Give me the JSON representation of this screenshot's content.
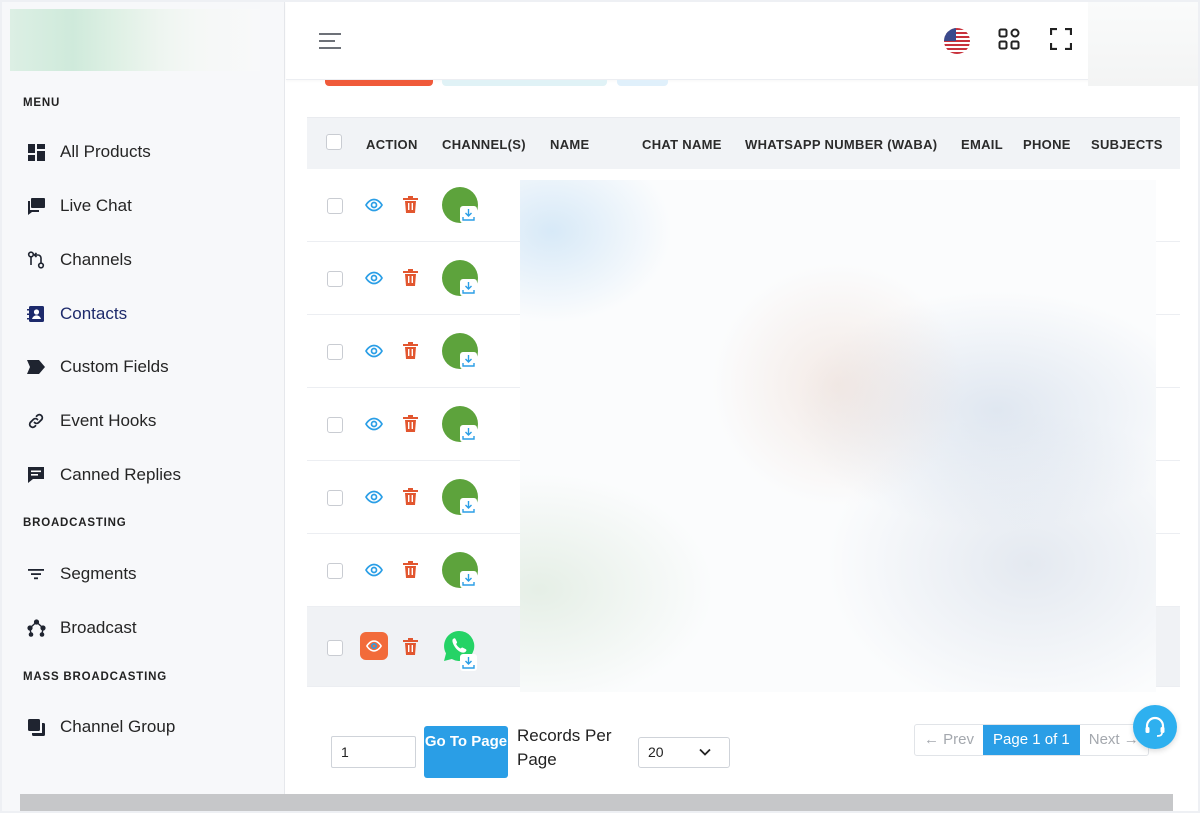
{
  "sidebar": {
    "sections": {
      "menu": "MENU",
      "broadcasting": "BROADCASTING",
      "mass_broadcasting": "MASS BROADCASTING"
    },
    "items": [
      {
        "label": "All Products",
        "icon": "grid-icon"
      },
      {
        "label": "Live Chat",
        "icon": "chat-icon"
      },
      {
        "label": "Channels",
        "icon": "channels-icon"
      },
      {
        "label": "Contacts",
        "icon": "contacts-icon",
        "active": true
      },
      {
        "label": "Custom Fields",
        "icon": "tag-icon"
      },
      {
        "label": "Event Hooks",
        "icon": "link-icon"
      },
      {
        "label": "Canned Replies",
        "icon": "canned-reply-icon"
      },
      {
        "label": "Segments",
        "icon": "filter-icon"
      },
      {
        "label": "Broadcast",
        "icon": "broadcast-icon"
      },
      {
        "label": "Channel Group",
        "icon": "channel-group-icon"
      }
    ]
  },
  "table": {
    "headers": [
      "ACTION",
      "CHANNEL(S)",
      "NAME",
      "CHAT NAME",
      "WHATSAPP NUMBER (WABA)",
      "EMAIL",
      "PHONE",
      "SUBJECTS"
    ]
  },
  "pagination": {
    "page_input_value": "1",
    "goto_label": "Go To Page",
    "records_per_page_label": "Records Per Page",
    "records_per_page_value": "20",
    "prev_label": "← Prev",
    "current_page_label": "Page 1 of 1",
    "next_label": "Next →"
  },
  "colors": {
    "accent": "#2a9ee6",
    "danger": "#e2562f",
    "channel_green": "#5da33c",
    "whatsapp_green": "#25d366"
  }
}
